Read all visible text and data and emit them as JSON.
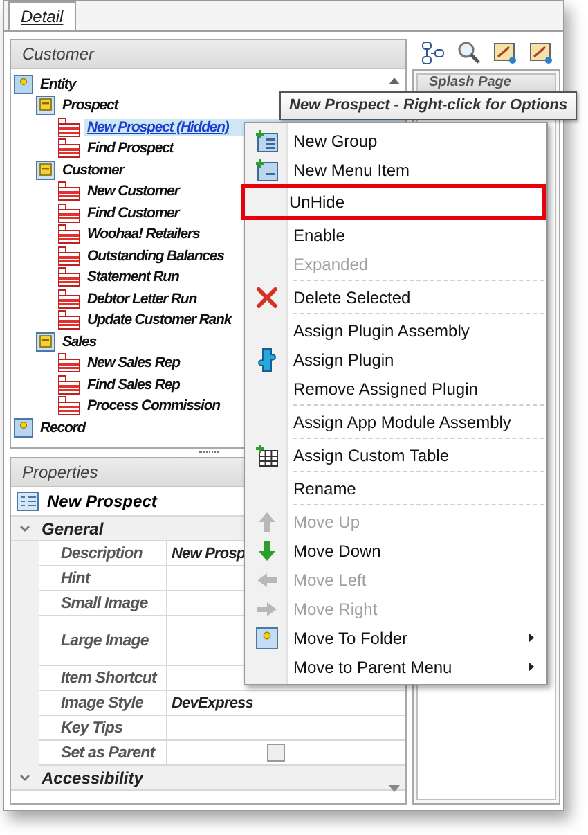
{
  "tabs": [
    {
      "label": "Detail",
      "selected": true
    }
  ],
  "customer_panel": {
    "title": "Customer",
    "tree": [
      {
        "label": "Entity",
        "kind": "folder",
        "selected": false,
        "children": [
          {
            "label": "Prospect",
            "kind": "group",
            "selected": false,
            "children": [
              {
                "label": "New Prospect (Hidden)",
                "kind": "item",
                "selected": true
              },
              {
                "label": "Find Prospect",
                "kind": "item",
                "selected": false
              }
            ]
          },
          {
            "label": "Customer",
            "kind": "group",
            "selected": false,
            "children": [
              {
                "label": "New Customer",
                "kind": "item",
                "selected": false
              },
              {
                "label": "Find Customer",
                "kind": "item",
                "selected": false
              },
              {
                "label": "Woohaa! Retailers",
                "kind": "item",
                "selected": false
              },
              {
                "label": "Outstanding Balances",
                "kind": "item",
                "selected": false
              },
              {
                "label": "Statement Run",
                "kind": "item",
                "selected": false
              },
              {
                "label": "Debtor Letter Run",
                "kind": "item",
                "selected": false
              },
              {
                "label": "Update Customer Rank",
                "kind": "item",
                "selected": false
              }
            ]
          },
          {
            "label": "Sales",
            "kind": "group",
            "selected": false,
            "children": [
              {
                "label": "New Sales Rep",
                "kind": "item",
                "selected": false
              },
              {
                "label": "Find Sales Rep",
                "kind": "item",
                "selected": false
              },
              {
                "label": "Process Commission",
                "kind": "item",
                "selected": false
              }
            ]
          }
        ]
      },
      {
        "label": "Record",
        "kind": "folder",
        "selected": false
      }
    ]
  },
  "tooltip": "New Prospect - Right-click for Options",
  "splash_panel": {
    "title": "Splash Page"
  },
  "properties": {
    "title": "Properties",
    "object": "New Prospect",
    "categories": [
      {
        "name": "General",
        "expanded": true,
        "rows": [
          {
            "name": "Description",
            "kind": "text",
            "value": "New Prosp"
          },
          {
            "name": "Hint",
            "kind": "text"
          },
          {
            "name": "Small Image",
            "kind": "text"
          },
          {
            "name": "Large Image",
            "kind": "large-image"
          },
          {
            "name": "Item Shortcut",
            "kind": "text"
          },
          {
            "name": "Image Style",
            "kind": "text",
            "value": "DevExpress"
          },
          {
            "name": "Key Tips",
            "kind": "text"
          },
          {
            "name": "Set as Parent",
            "kind": "checkbox",
            "checked": false
          }
        ]
      },
      {
        "name": "Accessibility",
        "expanded": true
      }
    ]
  },
  "context_menu": [
    {
      "kind": "item",
      "label": "New Group",
      "disabled": false,
      "highlighted": false,
      "submenu": false
    },
    {
      "kind": "item",
      "label": "New Menu Item",
      "disabled": false,
      "highlighted": false,
      "submenu": false
    },
    {
      "kind": "item",
      "label": "UnHide",
      "disabled": false,
      "highlighted": true,
      "submenu": false
    },
    {
      "kind": "item",
      "label": "Enable",
      "disabled": false,
      "highlighted": false,
      "submenu": false
    },
    {
      "kind": "item",
      "label": "Expanded",
      "disabled": true,
      "highlighted": false,
      "submenu": false
    },
    {
      "kind": "separator"
    },
    {
      "kind": "item",
      "label": "Delete Selected",
      "disabled": false,
      "highlighted": false,
      "submenu": false
    },
    {
      "kind": "separator"
    },
    {
      "kind": "item",
      "label": "Assign Plugin Assembly",
      "disabled": false,
      "highlighted": false,
      "submenu": false
    },
    {
      "kind": "item",
      "label": "Assign Plugin",
      "disabled": false,
      "highlighted": false,
      "submenu": false
    },
    {
      "kind": "item",
      "label": "Remove Assigned Plugin",
      "disabled": false,
      "highlighted": false,
      "submenu": false
    },
    {
      "kind": "separator"
    },
    {
      "kind": "item",
      "label": "Assign App Module Assembly",
      "disabled": false,
      "highlighted": false,
      "submenu": false
    },
    {
      "kind": "separator"
    },
    {
      "kind": "item",
      "label": "Assign Custom Table",
      "disabled": false,
      "highlighted": false,
      "submenu": false
    },
    {
      "kind": "separator"
    },
    {
      "kind": "item",
      "label": "Rename",
      "disabled": false,
      "highlighted": false,
      "submenu": false
    },
    {
      "kind": "separator"
    },
    {
      "kind": "item",
      "label": "Move Up",
      "disabled": true,
      "highlighted": false,
      "submenu": false
    },
    {
      "kind": "item",
      "label": "Move Down",
      "disabled": false,
      "highlighted": false,
      "submenu": false
    },
    {
      "kind": "item",
      "label": "Move Left",
      "disabled": true,
      "highlighted": false,
      "submenu": false
    },
    {
      "kind": "item",
      "label": "Move Right",
      "disabled": true,
      "highlighted": false,
      "submenu": false
    },
    {
      "kind": "item",
      "label": "Move To Folder",
      "disabled": false,
      "highlighted": false,
      "submenu": true
    },
    {
      "kind": "item",
      "label": "Move to Parent Menu",
      "disabled": false,
      "highlighted": false,
      "submenu": true
    }
  ]
}
